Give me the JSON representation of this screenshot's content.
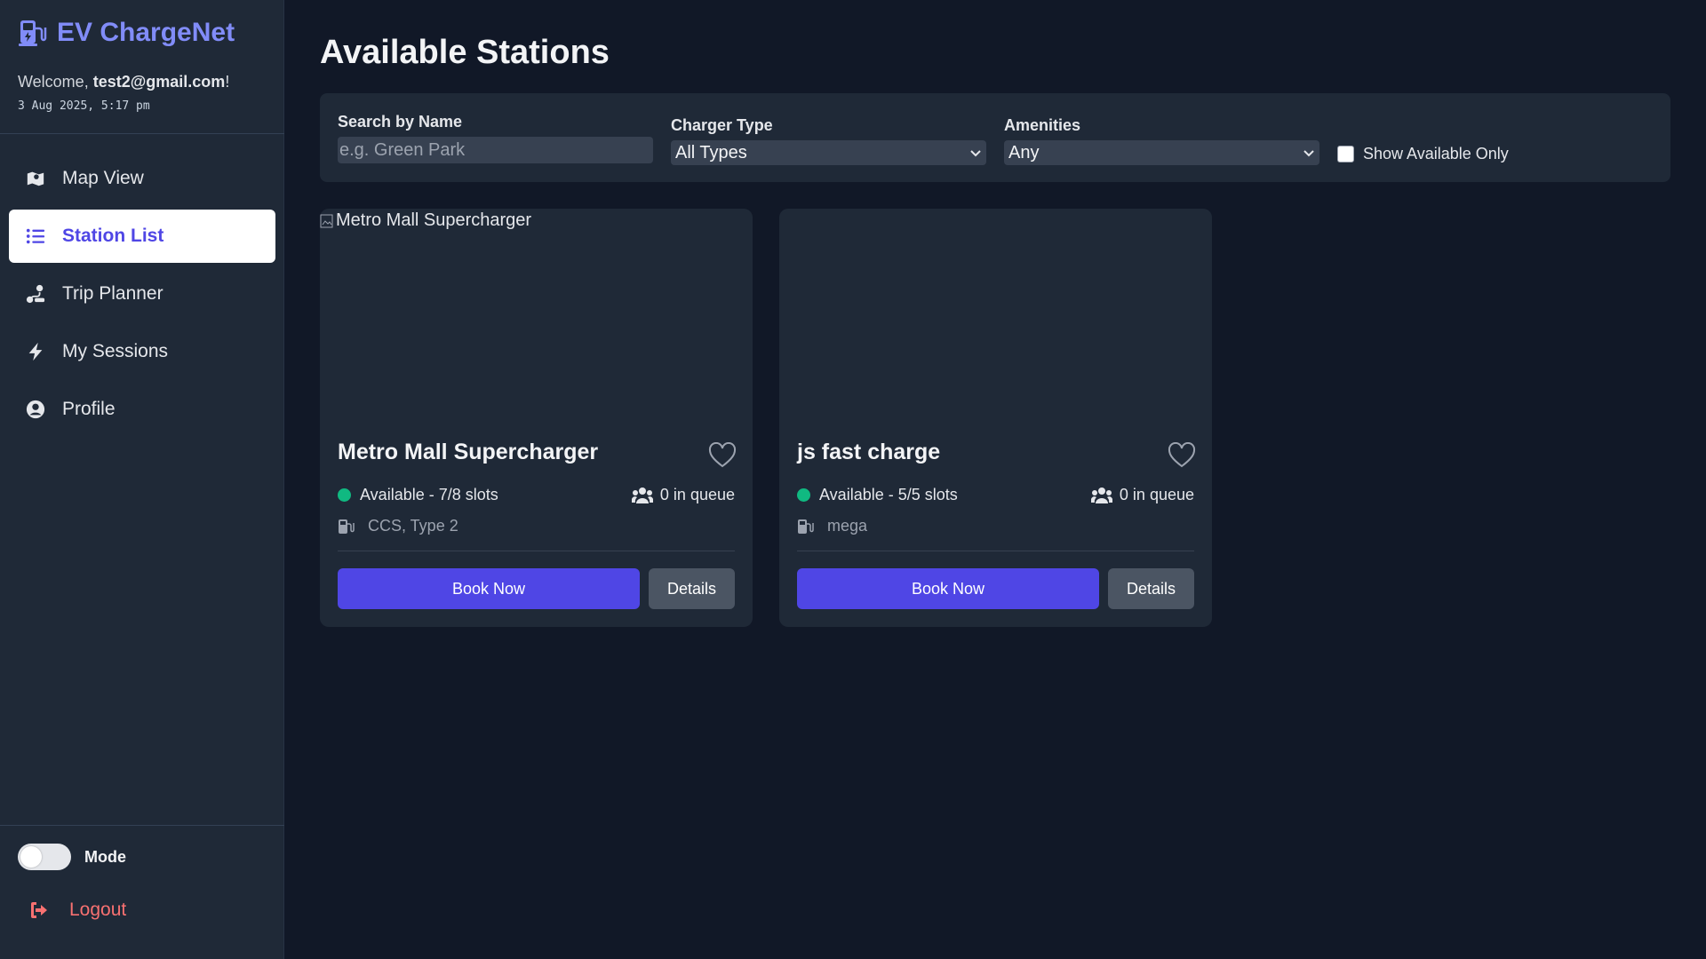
{
  "app": {
    "title": "EV ChargeNet",
    "welcome_prefix": "Welcome, ",
    "user_email": "test2@gmail.com",
    "welcome_suffix": "!",
    "datetime": "3 Aug 2025, 5:17 pm"
  },
  "sidebar": {
    "items": [
      {
        "label": "Map View",
        "icon": "map-icon",
        "active": false
      },
      {
        "label": "Station List",
        "icon": "list-icon",
        "active": true
      },
      {
        "label": "Trip Planner",
        "icon": "route-icon",
        "active": false
      },
      {
        "label": "My Sessions",
        "icon": "bolt-icon",
        "active": false
      },
      {
        "label": "Profile",
        "icon": "user-circle-icon",
        "active": false
      }
    ],
    "mode_label": "Mode",
    "logout_label": "Logout"
  },
  "main": {
    "title": "Available Stations",
    "filters": {
      "search_label": "Search by Name",
      "search_placeholder": "e.g. Green Park",
      "search_value": "",
      "charger_label": "Charger Type",
      "charger_value": "All Types",
      "amenities_label": "Amenities",
      "amenities_value": "Any",
      "available_only_label": "Show Available Only",
      "available_only_checked": false
    },
    "stations": [
      {
        "name": "Metro Mall Supercharger",
        "image_alt": "Metro Mall Supercharger",
        "status": "Available - 7/8 slots",
        "queue": "0 in queue",
        "chargers": "CCS, Type 2",
        "book_label": "Book Now",
        "details_label": "Details"
      },
      {
        "name": "js fast charge",
        "image_alt": "",
        "status": "Available - 5/5 slots",
        "queue": "0 in queue",
        "chargers": "mega",
        "book_label": "Book Now",
        "details_label": "Details"
      }
    ]
  },
  "colors": {
    "background": "#111827",
    "panel": "#1f2937",
    "accent": "#4f46e5",
    "brand": "#818cf8",
    "available": "#10b981",
    "logout": "#f87171"
  }
}
